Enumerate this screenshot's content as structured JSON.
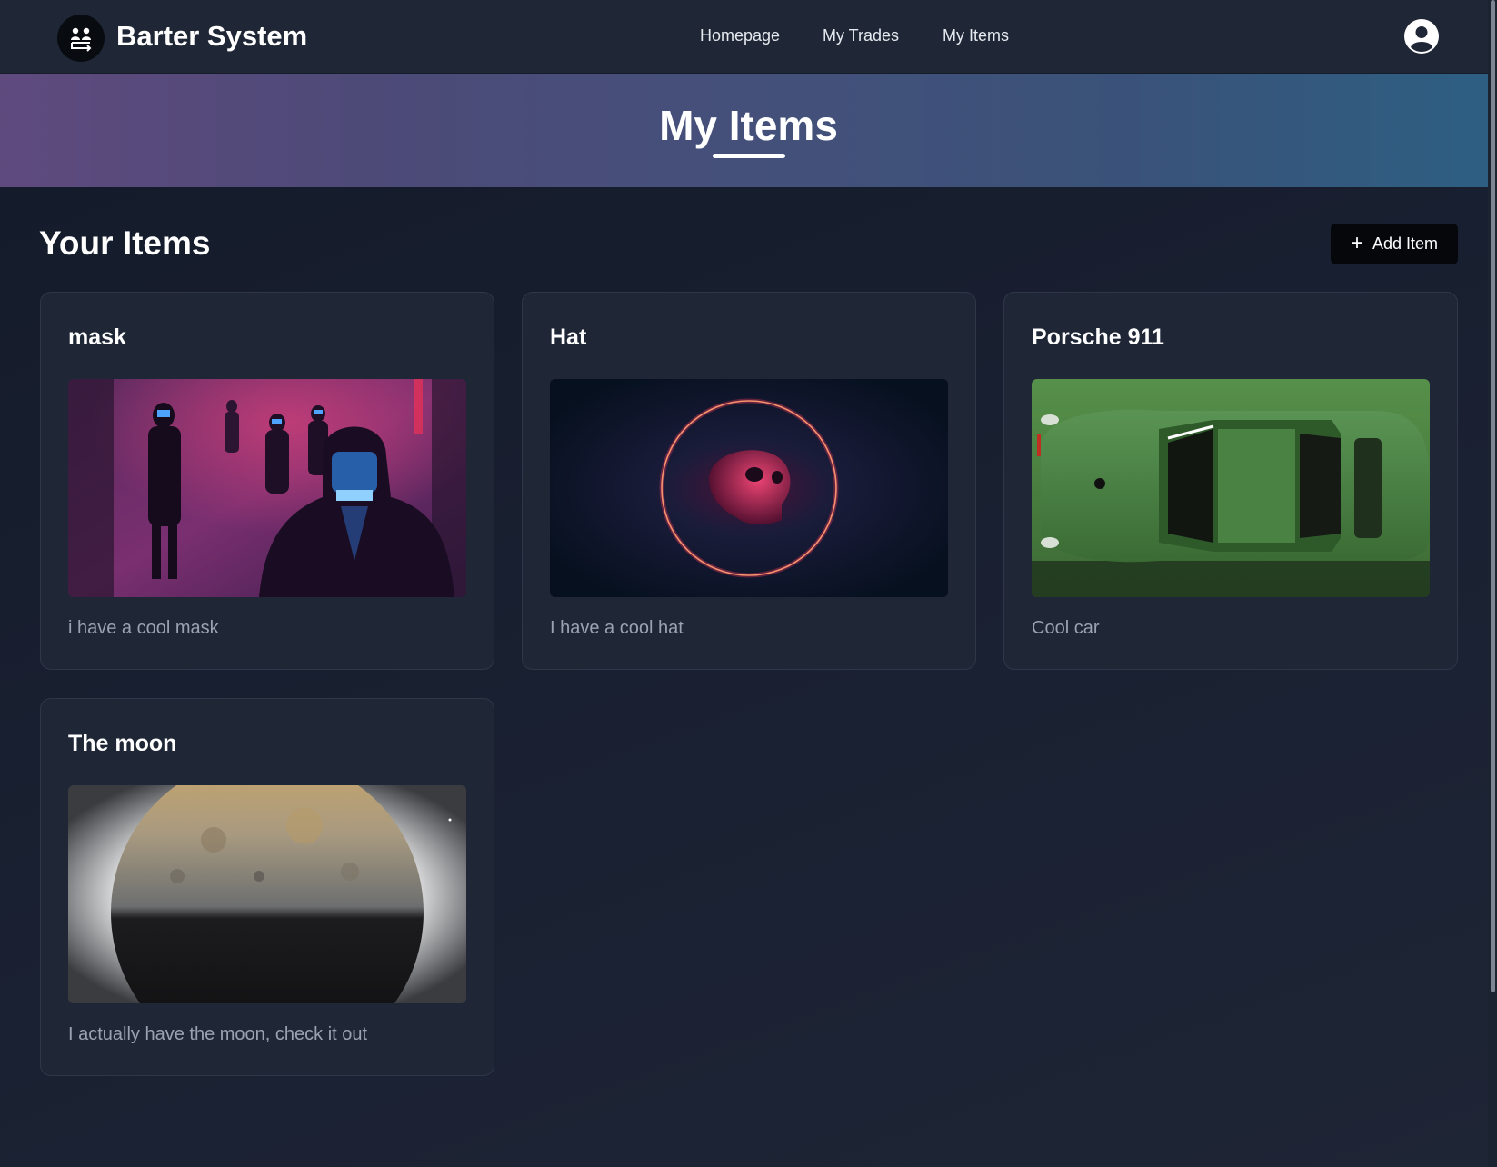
{
  "header": {
    "brand": "Barter System",
    "logo_icon": "users-exchange-icon",
    "nav": [
      {
        "label": "Homepage"
      },
      {
        "label": "My Trades"
      },
      {
        "label": "My Items"
      }
    ],
    "profile_icon": "user-circle-icon"
  },
  "hero": {
    "title": "My Items"
  },
  "section": {
    "title": "Your Items",
    "add_button_label": "Add Item",
    "add_button_icon": "plus-icon"
  },
  "items": [
    {
      "title": "mask",
      "description": "i have a cool mask"
    },
    {
      "title": "Hat",
      "description": "I have a cool hat"
    },
    {
      "title": "Porsche 911",
      "description": "Cool car"
    },
    {
      "title": "The moon",
      "description": "I actually have the moon, check it out"
    }
  ],
  "colors": {
    "background": "#161d2b",
    "navbar": "#1f2736",
    "card": "#1f2737",
    "card_border": "#2e3748",
    "description": "#9aa3b2",
    "hero_start": "#5f4a7e",
    "hero_end": "#2d5f82"
  }
}
